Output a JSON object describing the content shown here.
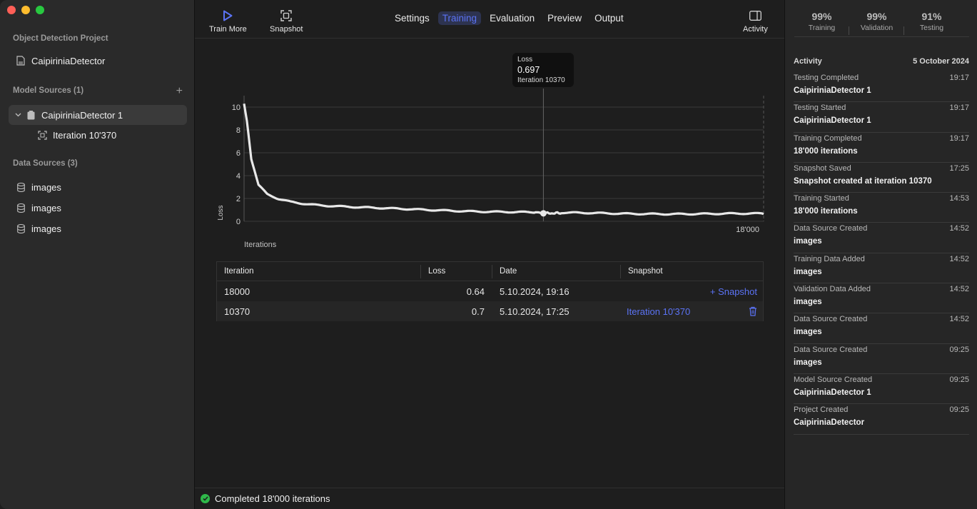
{
  "sidebar": {
    "project_section": "Object Detection Project",
    "project_name": "CaipiriniaDetector",
    "model_sources_section": "Model Sources (1)",
    "model_source": "CaipiriniaDetector 1",
    "iteration_item": "Iteration 10'370",
    "data_sources_section": "Data Sources (3)",
    "data_sources": [
      "images",
      "images",
      "images"
    ]
  },
  "toolbar": {
    "train_more": "Train More",
    "snapshot": "Snapshot",
    "activity": "Activity",
    "tabs": [
      "Settings",
      "Training",
      "Evaluation",
      "Preview",
      "Output"
    ],
    "active_tab": "Training",
    "accent": "#5b73f5"
  },
  "tooltip": {
    "title": "Loss",
    "value": "0.697",
    "detail": "Iteration 10370"
  },
  "chart_data": {
    "type": "line",
    "title": "",
    "xlabel": "Iterations",
    "ylabel": "Loss",
    "xlim": [
      0,
      18000
    ],
    "ylim": [
      0,
      10
    ],
    "y_ticks": [
      "0",
      "2",
      "4",
      "6",
      "8",
      "10"
    ],
    "x_tick_label": "18'000",
    "grid": true,
    "series": [
      {
        "x": [
          0,
          100,
          250,
          500,
          800,
          1200,
          1600,
          2000,
          2500,
          3000,
          4000,
          5000,
          6000,
          7000,
          8000,
          9000,
          10000,
          10370,
          11000,
          12000,
          13000,
          14000,
          15000,
          16000,
          17000,
          18000
        ],
        "values": [
          10.3,
          8.8,
          5.5,
          3.2,
          2.4,
          2.0,
          1.75,
          1.6,
          1.45,
          1.35,
          1.2,
          1.1,
          1.02,
          0.96,
          0.9,
          0.85,
          0.78,
          0.697,
          0.72,
          0.7,
          0.68,
          0.68,
          0.67,
          0.66,
          0.65,
          0.64
        ]
      }
    ],
    "highlight_x": 10370,
    "highlight_y": 0.697,
    "line_color": "#e8e8e8"
  },
  "table": {
    "headers": [
      "Iteration",
      "Loss",
      "Date",
      "Snapshot"
    ],
    "rows": [
      {
        "iteration": "18000",
        "loss": "0.64",
        "date": "5.10.2024, 19:16",
        "snapshot": "+ Snapshot"
      },
      {
        "iteration": "10370",
        "loss": "0.7",
        "date": "5.10.2024, 17:25",
        "snapshot": "Iteration 10'370"
      }
    ]
  },
  "status": {
    "text": "Completed 18'000 iterations"
  },
  "stats": [
    {
      "value": "99%",
      "label": "Training"
    },
    {
      "value": "99%",
      "label": "Validation"
    },
    {
      "value": "91%",
      "label": "Testing"
    }
  ],
  "activity": {
    "header": "Activity",
    "date": "5 October 2024",
    "items": [
      {
        "title": "Testing Completed",
        "time": "19:17",
        "detail": "CaipiriniaDetector 1"
      },
      {
        "title": "Testing Started",
        "time": "19:17",
        "detail": "CaipiriniaDetector 1"
      },
      {
        "title": "Training Completed",
        "time": "19:17",
        "detail": "18'000 iterations"
      },
      {
        "title": "Snapshot Saved",
        "time": "17:25",
        "detail": "Snapshot created at iteration 10370"
      },
      {
        "title": "Training Started",
        "time": "14:53",
        "detail": "18'000 iterations"
      },
      {
        "title": "Data Source Created",
        "time": "14:52",
        "detail": "images"
      },
      {
        "title": "Training Data Added",
        "time": "14:52",
        "detail": "images"
      },
      {
        "title": "Validation Data Added",
        "time": "14:52",
        "detail": "images"
      },
      {
        "title": "Data Source Created",
        "time": "14:52",
        "detail": "images"
      },
      {
        "title": "Data Source Created",
        "time": "09:25",
        "detail": "images"
      },
      {
        "title": "Model Source Created",
        "time": "09:25",
        "detail": "CaipiriniaDetector 1"
      },
      {
        "title": "Project Created",
        "time": "09:25",
        "detail": "CaipiriniaDetector"
      }
    ]
  }
}
